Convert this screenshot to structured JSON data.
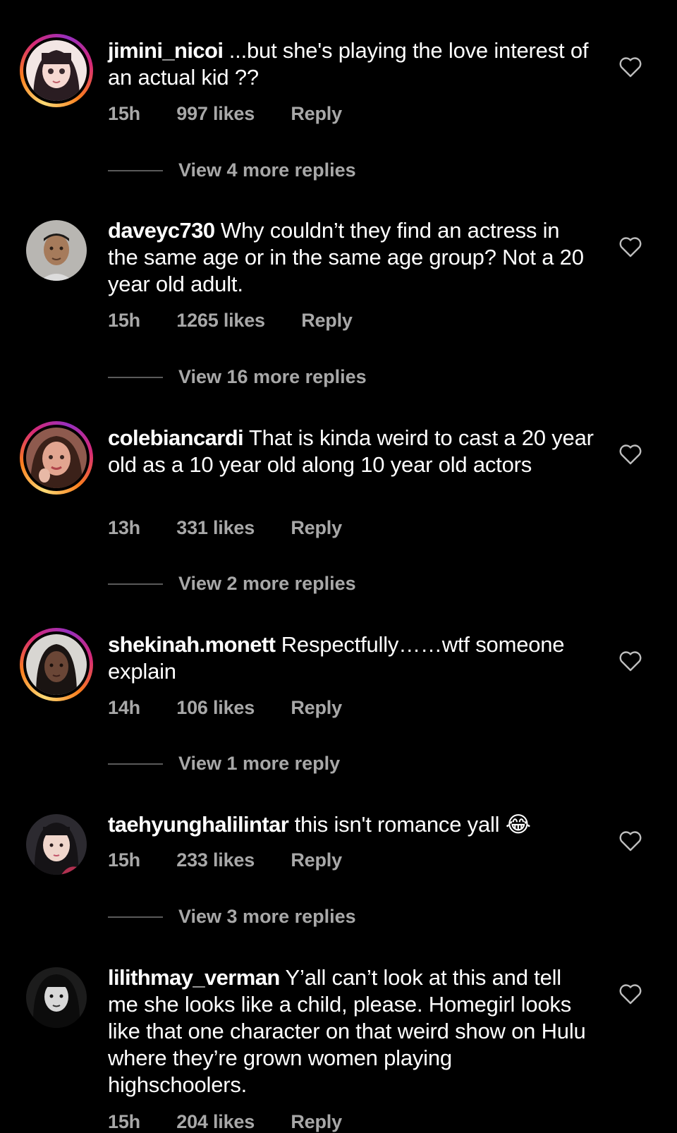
{
  "comments": [
    {
      "username": "jimini_nicoi",
      "text": "...but she's playing the love interest of an actual kid ??",
      "time": "15h",
      "likes": "997 likes",
      "reply": "Reply",
      "view_replies": "View 4 more replies",
      "has_story": true,
      "avatar_color": "#f2e6e4"
    },
    {
      "username": "daveyc730",
      "text": "Why couldn’t they find an actress in the same age or in the same age group? Not a 20 year old adult.",
      "time": "15h",
      "likes": "1265 likes",
      "reply": "Reply",
      "view_replies": "View 16 more replies",
      "has_story": false,
      "avatar_color": "#b8b6b2"
    },
    {
      "username": "colebiancardi",
      "text": "That is kinda weird to cast a 20 year old as a 10 year old along 10 year old actors",
      "time": "13h",
      "likes": "331 likes",
      "reply": "Reply",
      "view_replies": "View 2 more replies",
      "has_story": true,
      "avatar_color": "#c98372"
    },
    {
      "username": "shekinah.monett",
      "text": "Respectfully……wtf someone explain",
      "time": "14h",
      "likes": "106 likes",
      "reply": "Reply",
      "view_replies": "View 1 more reply",
      "has_story": true,
      "avatar_color": "#d8d6d2"
    },
    {
      "username": "taehyunghalilintar",
      "text": "this isn't romance yall 😂",
      "time": "15h",
      "likes": "233 likes",
      "reply": "Reply",
      "view_replies": "View 3 more replies",
      "has_story": false,
      "avatar_color": "#2c2a30"
    },
    {
      "username": "lilithmay_verman",
      "text": "Y’all can’t look at this and tell me she looks like a child, please. Homegirl looks like that one character on that weird show on Hulu where they’re grown women playing highschoolers.",
      "time": "15h",
      "likes": "204 likes",
      "reply": "Reply",
      "has_story": false,
      "avatar_color": "#1c1c1c"
    }
  ],
  "colors": {
    "background": "#000000",
    "text": "#ffffff",
    "secondary_text": "#a8a8a8",
    "divider": "#5a5a5a"
  },
  "icons": {
    "like": "heart-outline-icon"
  }
}
